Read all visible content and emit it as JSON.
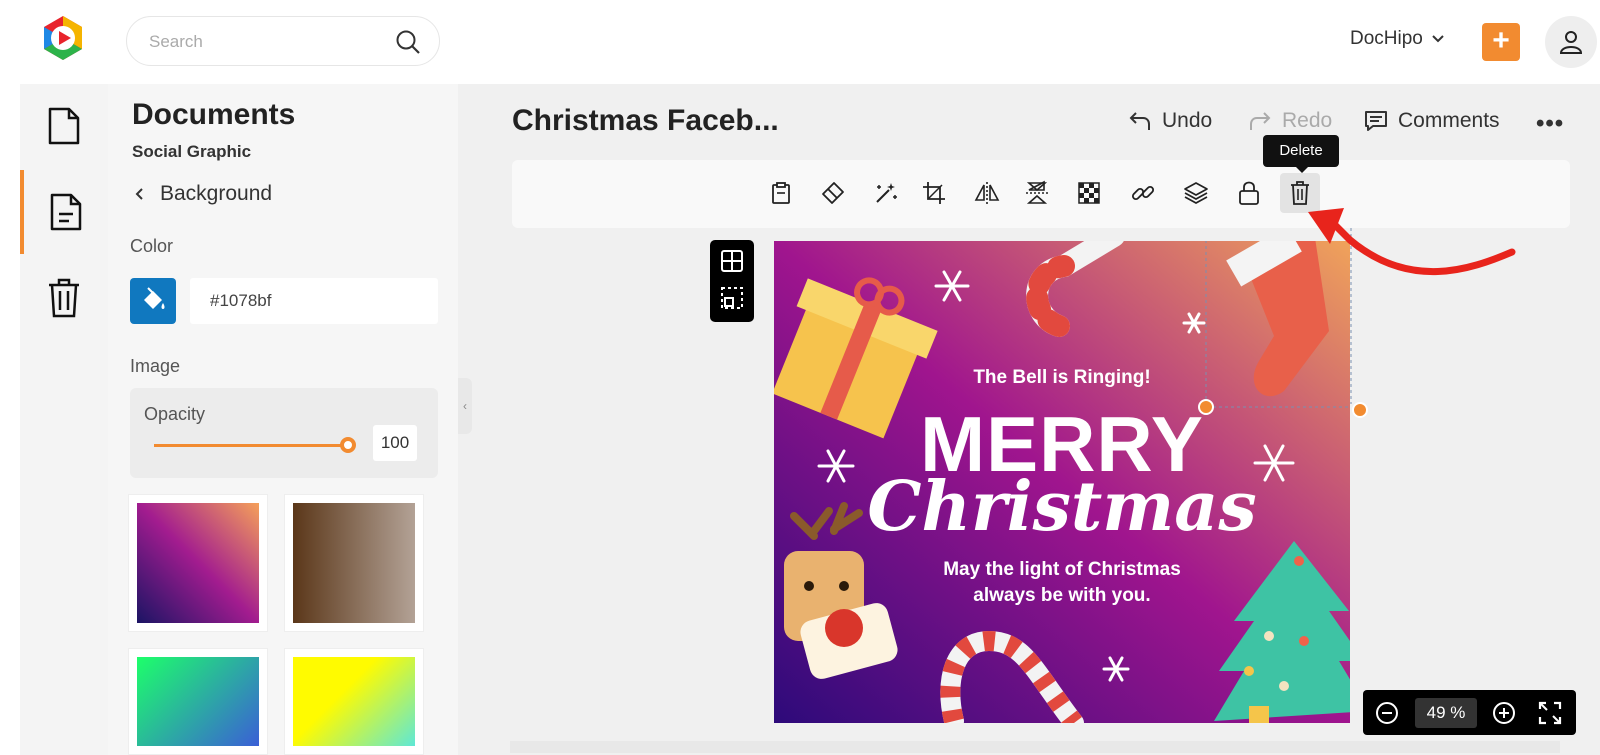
{
  "topbar": {
    "search_placeholder": "Search",
    "account_name": "DocHipo",
    "add_label": "+"
  },
  "rail": {
    "items": [
      {
        "icon": "document-icon"
      },
      {
        "icon": "page-icon",
        "active": true
      },
      {
        "icon": "trash-icon"
      }
    ]
  },
  "panel": {
    "title": "Documents",
    "subtitle": "Social Graphic",
    "back_label": "Background",
    "color_label": "Color",
    "color_value": "#1078bf",
    "image_label": "Image",
    "opacity_label": "Opacity",
    "opacity_value": "100",
    "gradients": [
      {
        "from": "#1b1464",
        "mid": "#a21c8f",
        "to": "#f5a05a"
      },
      {
        "from": "#5b3719",
        "to": "#b3a296"
      },
      {
        "from": "#1dff6a",
        "to": "#3a5fd6"
      },
      {
        "from": "#fffb00",
        "to": "#5ee8d6"
      }
    ]
  },
  "editor": {
    "doc_title": "Christmas Faceb...",
    "undo_label": "Undo",
    "redo_label": "Redo",
    "comments_label": "Comments",
    "more_label": "•••",
    "tooltip": "Delete",
    "tools": [
      "clipboard-icon",
      "eraser-icon",
      "magic-wand-icon",
      "crop-icon",
      "flip-horizontal-icon",
      "flip-vertical-icon",
      "transparency-icon",
      "link-icon",
      "layers-icon",
      "lock-icon",
      "trash-icon"
    ],
    "zoom_value": "49",
    "zoom_unit": "%"
  },
  "design": {
    "tagline": "The Bell is Ringing!",
    "headline": "MERRY",
    "script": "Christmas",
    "message_line1": "May the light of Christmas",
    "message_line2": "always be with you.",
    "accent": "#f28b30",
    "arrow_color": "#e8241c"
  }
}
